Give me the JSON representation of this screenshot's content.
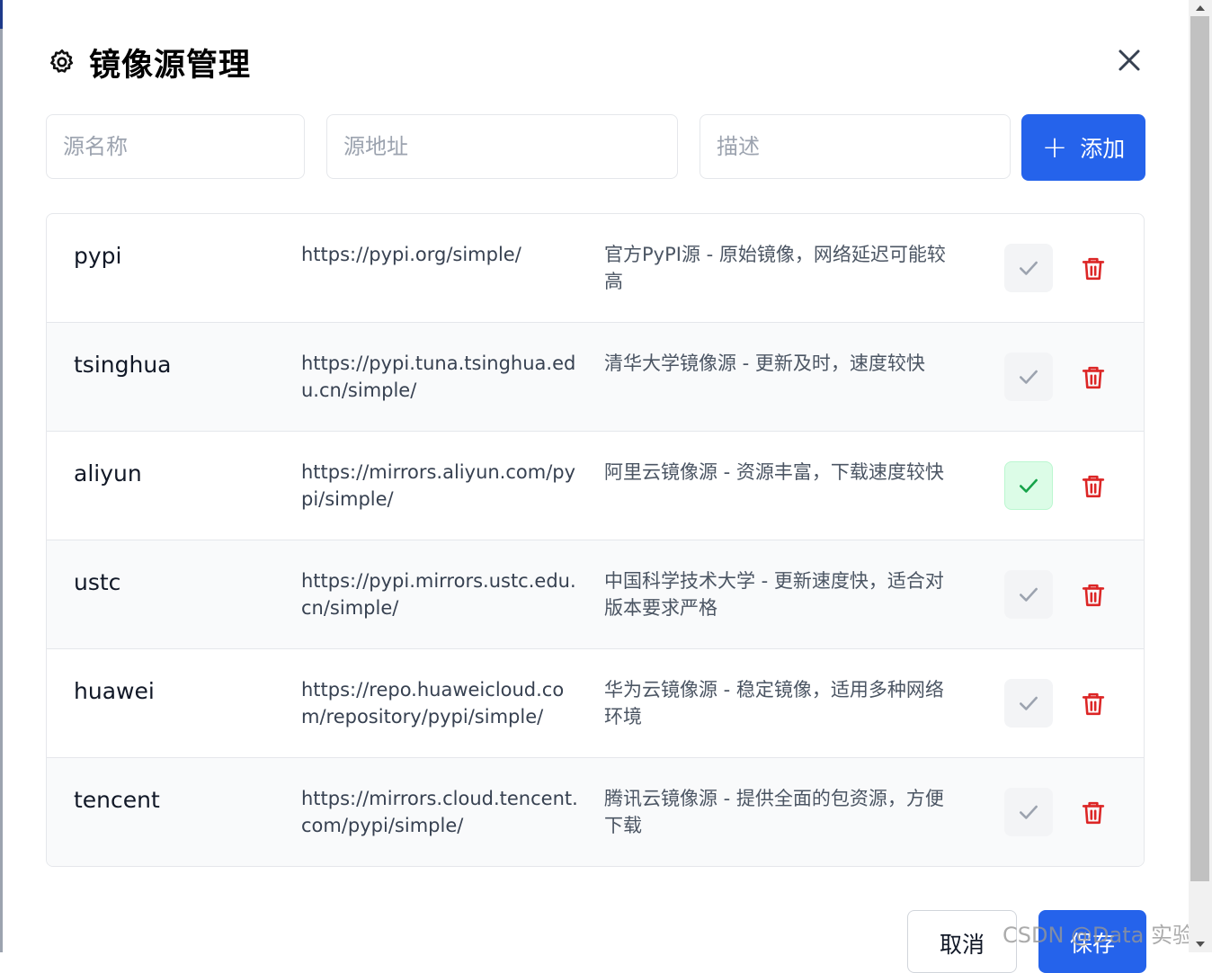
{
  "dialog": {
    "title": "镜像源管理",
    "close_icon": "close-icon"
  },
  "form": {
    "name_placeholder": "源名称",
    "url_placeholder": "源地址",
    "desc_placeholder": "描述",
    "add_label": "添加"
  },
  "sources": [
    {
      "name": "pypi",
      "url": "https://pypi.org/simple/",
      "desc": "官方PyPI源 - 原始镜像，网络延迟可能较高",
      "active": false
    },
    {
      "name": "tsinghua",
      "url": "https://pypi.tuna.tsinghua.edu.cn/simple/",
      "desc": "清华大学镜像源 - 更新及时，速度较快",
      "active": false
    },
    {
      "name": "aliyun",
      "url": "https://mirrors.aliyun.com/pypi/simple/",
      "desc": "阿里云镜像源 - 资源丰富，下载速度较快",
      "active": true
    },
    {
      "name": "ustc",
      "url": "https://pypi.mirrors.ustc.edu.cn/simple/",
      "desc": "中国科学技术大学 - 更新速度快，适合对版本要求严格",
      "active": false
    },
    {
      "name": "huawei",
      "url": "https://repo.huaweicloud.com/repository/pypi/simple/",
      "desc": "华为云镜像源 - 稳定镜像，适用多种网络环境",
      "active": false
    },
    {
      "name": "tencent",
      "url": "https://mirrors.cloud.tencent.com/pypi/simple/",
      "desc": "腾讯云镜像源 - 提供全面的包资源，方便下载",
      "active": false
    }
  ],
  "footer": {
    "cancel_label": "取消",
    "save_label": "保存"
  },
  "watermark": "CSDN @Data 实验室",
  "colors": {
    "primary": "#2563eb",
    "danger": "#dc2626",
    "success": "#16a34a",
    "success_bg": "#dcfce7"
  }
}
